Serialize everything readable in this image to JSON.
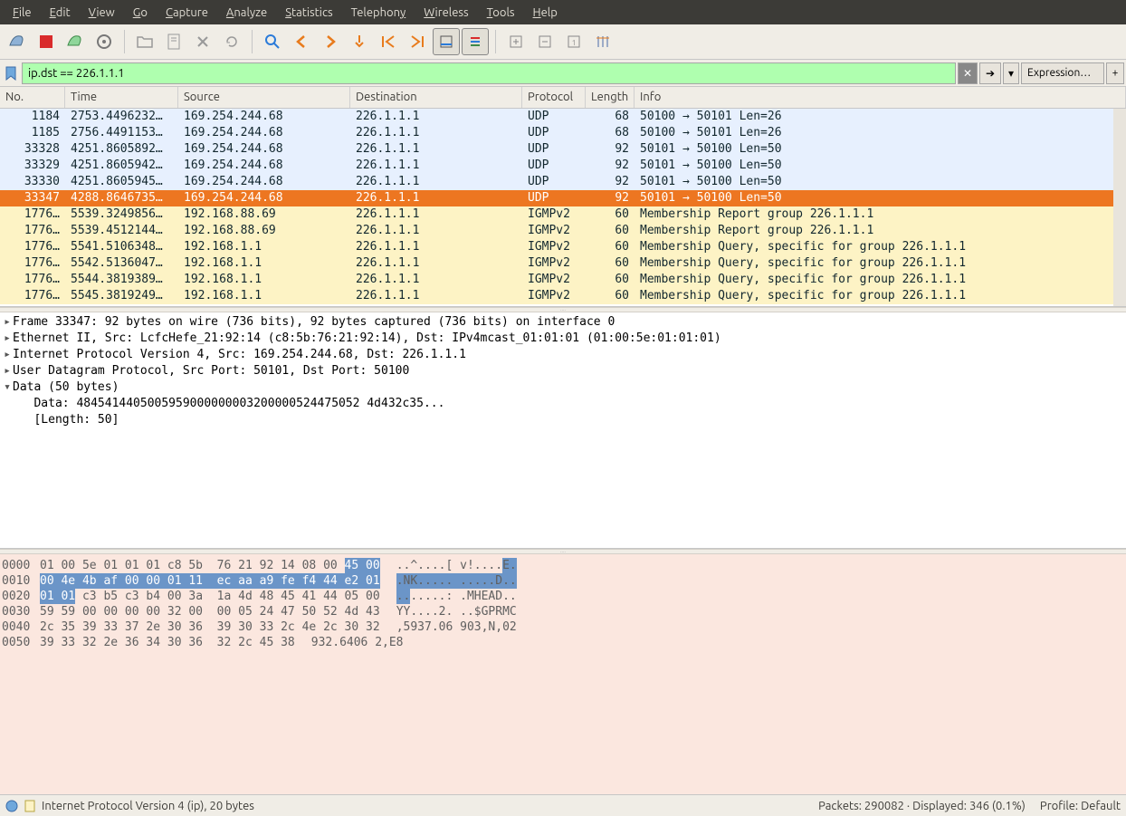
{
  "menu": [
    "File",
    "Edit",
    "View",
    "Go",
    "Capture",
    "Analyze",
    "Statistics",
    "Telephony",
    "Wireless",
    "Tools",
    "Help"
  ],
  "filter": {
    "value": "ip.dst == 226.1.1.1",
    "expression": "Expression…"
  },
  "columns": [
    "No.",
    "Time",
    "Source",
    "Destination",
    "Protocol",
    "Length",
    "Info"
  ],
  "packets": [
    {
      "no": "1184",
      "time": "2753.4496232…",
      "src": "169.254.244.68",
      "dst": "226.1.1.1",
      "proto": "UDP",
      "len": "68",
      "info": "50100 → 50101 Len=26",
      "cls": "row-blue"
    },
    {
      "no": "1185",
      "time": "2756.4491153…",
      "src": "169.254.244.68",
      "dst": "226.1.1.1",
      "proto": "UDP",
      "len": "68",
      "info": "50100 → 50101 Len=26",
      "cls": "row-blue"
    },
    {
      "no": "33328",
      "time": "4251.8605892…",
      "src": "169.254.244.68",
      "dst": "226.1.1.1",
      "proto": "UDP",
      "len": "92",
      "info": "50101 → 50100 Len=50",
      "cls": "row-blue"
    },
    {
      "no": "33329",
      "time": "4251.8605942…",
      "src": "169.254.244.68",
      "dst": "226.1.1.1",
      "proto": "UDP",
      "len": "92",
      "info": "50101 → 50100 Len=50",
      "cls": "row-blue"
    },
    {
      "no": "33330",
      "time": "4251.8605945…",
      "src": "169.254.244.68",
      "dst": "226.1.1.1",
      "proto": "UDP",
      "len": "92",
      "info": "50101 → 50100 Len=50",
      "cls": "row-blue"
    },
    {
      "no": "33347",
      "time": "4288.8646735…",
      "src": "169.254.244.68",
      "dst": "226.1.1.1",
      "proto": "UDP",
      "len": "92",
      "info": "50101 → 50100 Len=50",
      "cls": "row-sel"
    },
    {
      "no": "1776…",
      "time": "5539.3249856…",
      "src": "192.168.88.69",
      "dst": "226.1.1.1",
      "proto": "IGMPv2",
      "len": "60",
      "info": "Membership Report group 226.1.1.1",
      "cls": "row-yel"
    },
    {
      "no": "1776…",
      "time": "5539.4512144…",
      "src": "192.168.88.69",
      "dst": "226.1.1.1",
      "proto": "IGMPv2",
      "len": "60",
      "info": "Membership Report group 226.1.1.1",
      "cls": "row-yel"
    },
    {
      "no": "1776…",
      "time": "5541.5106348…",
      "src": "192.168.1.1",
      "dst": "226.1.1.1",
      "proto": "IGMPv2",
      "len": "60",
      "info": "Membership Query, specific for group 226.1.1.1",
      "cls": "row-yel"
    },
    {
      "no": "1776…",
      "time": "5542.5136047…",
      "src": "192.168.1.1",
      "dst": "226.1.1.1",
      "proto": "IGMPv2",
      "len": "60",
      "info": "Membership Query, specific for group 226.1.1.1",
      "cls": "row-yel"
    },
    {
      "no": "1776…",
      "time": "5544.3819389…",
      "src": "192.168.1.1",
      "dst": "226.1.1.1",
      "proto": "IGMPv2",
      "len": "60",
      "info": "Membership Query, specific for group 226.1.1.1",
      "cls": "row-yel"
    },
    {
      "no": "1776…",
      "time": "5545.3819249…",
      "src": "192.168.1.1",
      "dst": "226.1.1.1",
      "proto": "IGMPv2",
      "len": "60",
      "info": "Membership Query, specific for group 226.1.1.1",
      "cls": "row-yel"
    }
  ],
  "details": [
    {
      "tri": "▸",
      "text": "Frame 33347: 92 bytes on wire (736 bits), 92 bytes captured (736 bits) on interface 0"
    },
    {
      "tri": "▸",
      "text": "Ethernet II, Src: LcfcHefe_21:92:14 (c8:5b:76:21:92:14), Dst: IPv4mcast_01:01:01 (01:00:5e:01:01:01)"
    },
    {
      "tri": "▸",
      "text": "Internet Protocol Version 4, Src: 169.254.244.68, Dst: 226.1.1.1"
    },
    {
      "tri": "▸",
      "text": "User Datagram Protocol, Src Port: 50101, Dst Port: 50100"
    },
    {
      "tri": "▾",
      "text": "Data (50 bytes)"
    },
    {
      "tri": "",
      "text": "   Data: 4845414405005959000000003200000524475052 4d432c35..."
    },
    {
      "tri": "",
      "text": "   [Length: 50]"
    }
  ],
  "hex": [
    {
      "off": "0000",
      "b1": "01 00 5e 01 01 01 c8 5b  76 21 92 14 08 00 ",
      "b2": "45 00",
      "a1": "..^....[ v!....",
      "a2": "E."
    },
    {
      "off": "0010",
      "b1": "",
      "b2": "00 4e 4b af 00 00 01 11  ec aa a9 fe f4 44 e2 01",
      "a1": "",
      "a2": ".NK..... .....D.."
    },
    {
      "off": "0020",
      "b1": "",
      "b2": "01 01",
      "b3": " c3 b5 c3 b4 00 3a  1a 4d 48 45 41 44 05 00",
      "a1": "",
      "a2": "..",
      "a3": ".....: .MHEAD.."
    },
    {
      "off": "0030",
      "b1": "59 59 00 00 00 00 32 00  00 05 24 47 50 52 4d 43",
      "a1": "YY....2. ..$GPRMC"
    },
    {
      "off": "0040",
      "b1": "2c 35 39 33 37 2e 30 36  39 30 33 2c 4e 2c 30 32",
      "a1": ",5937.06 903,N,02"
    },
    {
      "off": "0050",
      "b1": "39 33 32 2e 36 34 30 36  32 2c 45 38",
      "a1": "932.6406 2,E8"
    }
  ],
  "status": {
    "left": "Internet Protocol Version 4 (ip), 20 bytes",
    "packets": "Packets: 290082 · Displayed: 346 (0.1%)",
    "profile": "Profile: Default"
  }
}
